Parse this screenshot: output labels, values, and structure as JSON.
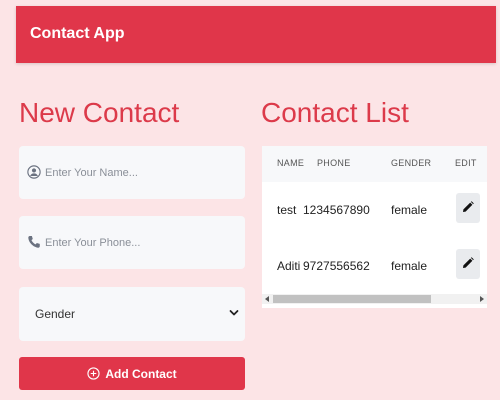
{
  "header": {
    "title": "Contact App"
  },
  "form": {
    "title": "New Contact",
    "name_placeholder": "Enter Your Name...",
    "phone_placeholder": "Enter Your Phone...",
    "gender_selected": "Gender",
    "gender_options": [
      "Gender"
    ],
    "submit_label": "Add Contact",
    "icons": {
      "name": "user-circle-icon",
      "phone": "phone-icon",
      "submit": "plus-circle-icon"
    }
  },
  "list": {
    "title": "Contact List",
    "columns": [
      "NAME",
      "PHONE",
      "GENDER",
      "EDIT"
    ],
    "rows": [
      {
        "name": "test",
        "phone": "1234567890",
        "gender": "female"
      },
      {
        "name": "Aditi",
        "phone": "9727556562",
        "gender": "female"
      }
    ],
    "edit_icon": "pencil-icon"
  },
  "colors": {
    "accent": "#e0364a",
    "background": "#fce4e6",
    "title": "#dc3a4a"
  }
}
